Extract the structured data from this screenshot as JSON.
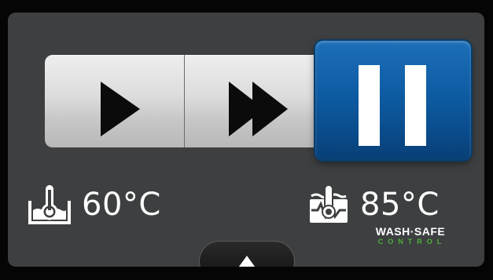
{
  "controls": {
    "play_icon": "play-icon",
    "fast_forward_icon": "fast-forward-icon",
    "pause_icon": "pause-icon",
    "active": "pause"
  },
  "wash": {
    "icon": "wash-tank-thermometer-icon",
    "temperature": "60°C"
  },
  "rinse": {
    "icon": "rinse-thermometer-icon",
    "temperature": "85°C"
  },
  "brand": {
    "line1": "WASH·SAFE",
    "line2": "CONTROL"
  },
  "nav": {
    "up_icon": "up-arrow-icon"
  },
  "colors": {
    "screen_bg": "#3d3f40",
    "pause_blue": "#0f5ea6",
    "brand_green": "#4caf3c"
  }
}
